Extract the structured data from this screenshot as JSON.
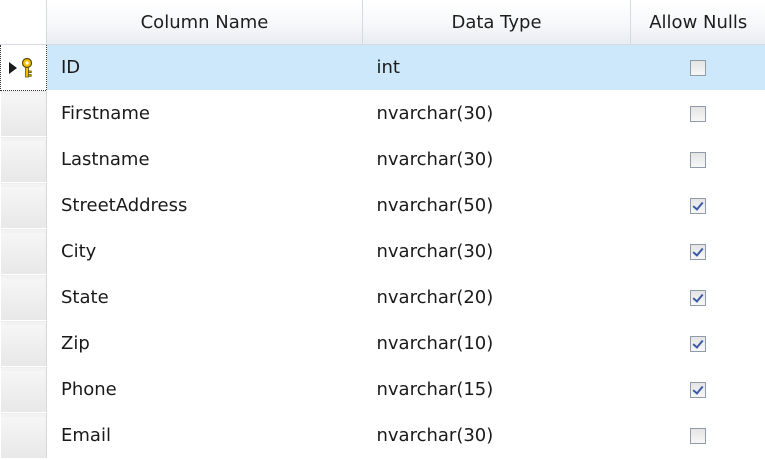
{
  "headers": {
    "column_name": "Column Name",
    "data_type": "Data Type",
    "allow_nulls": "Allow Nulls"
  },
  "rows": [
    {
      "name": "ID",
      "type": "int",
      "allow_nulls": false,
      "primary_key": true,
      "selected": true
    },
    {
      "name": "Firstname",
      "type": "nvarchar(30)",
      "allow_nulls": false
    },
    {
      "name": "Lastname",
      "type": "nvarchar(30)",
      "allow_nulls": false
    },
    {
      "name": "StreetAddress",
      "type": "nvarchar(50)",
      "allow_nulls": true
    },
    {
      "name": "City",
      "type": "nvarchar(30)",
      "allow_nulls": true
    },
    {
      "name": "State",
      "type": "nvarchar(20)",
      "allow_nulls": true
    },
    {
      "name": "Zip",
      "type": "nvarchar(10)",
      "allow_nulls": true
    },
    {
      "name": "Phone",
      "type": "nvarchar(15)",
      "allow_nulls": true
    },
    {
      "name": "Email",
      "type": "nvarchar(30)",
      "allow_nulls": false
    }
  ],
  "icons": {
    "primary_key": "primary-key-icon",
    "current_row": "row-pointer-icon"
  },
  "colors": {
    "selected_row": "#cde7fb",
    "key_yellow": "#f2c200",
    "check_blue": "#3b5aa8"
  }
}
